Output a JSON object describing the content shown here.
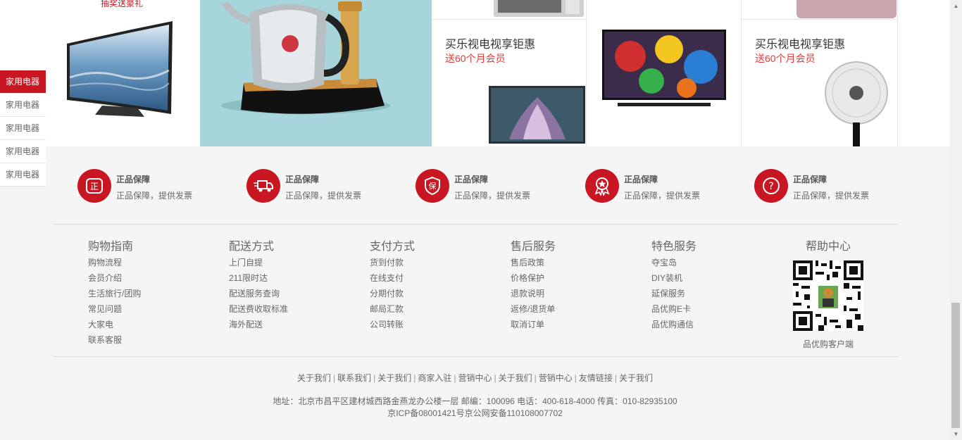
{
  "sidebar": {
    "items": [
      {
        "label": "家用电器",
        "active": true
      },
      {
        "label": "家用电器",
        "active": false
      },
      {
        "label": "家用电器",
        "active": false
      },
      {
        "label": "家用电器",
        "active": false
      },
      {
        "label": "家用电器",
        "active": false
      }
    ]
  },
  "products": {
    "tv_tag": "抽奖送豪礼",
    "promo_left": {
      "title": "买乐视电视享钜惠",
      "sub": "送60个月会员"
    },
    "promo_right": {
      "title": "买乐视电视享钜惠",
      "sub": "送60个月会员"
    }
  },
  "guarantees": [
    {
      "icon": "genuine-icon",
      "glyph": "正",
      "title": "正品保障",
      "desc": "正品保障，提供发票"
    },
    {
      "icon": "delivery-truck-icon",
      "glyph": "",
      "title": "正品保障",
      "desc": "正品保障，提供发票"
    },
    {
      "icon": "warranty-shield-icon",
      "glyph": "保",
      "title": "正品保障",
      "desc": "正品保障，提供发票"
    },
    {
      "icon": "award-ribbon-icon",
      "glyph": "",
      "title": "正品保障",
      "desc": "正品保障，提供发票"
    },
    {
      "icon": "help-question-icon",
      "glyph": "?",
      "title": "正品保障",
      "desc": "正品保障，提供发票"
    }
  ],
  "footer_columns": [
    {
      "title": "购物指南",
      "links": [
        "购物流程",
        "会员介绍",
        "生活旅行/团购",
        "常见问题",
        "大家电",
        "联系客服"
      ]
    },
    {
      "title": "配送方式",
      "links": [
        "上门自提",
        "211限时达",
        "配送服务查询",
        "配送费收取标准",
        "海外配送"
      ]
    },
    {
      "title": "支付方式",
      "links": [
        "货到付款",
        "在线支付",
        "分期付款",
        "邮局汇款",
        "公司转账"
      ]
    },
    {
      "title": "售后服务",
      "links": [
        "售后政策",
        "价格保护",
        "退款说明",
        "返修/退货单",
        "取消订单"
      ]
    },
    {
      "title": "特色服务",
      "links": [
        "夺宝岛",
        "DIY装机",
        "延保服务",
        "品优购E卡",
        "品优购通信"
      ]
    }
  ],
  "help": {
    "title": "帮助中心",
    "caption": "品优购客户端"
  },
  "bottom_links": [
    "关于我们",
    "联系我们",
    "关于我们",
    "商家入驻",
    "营销中心",
    "关于我们",
    "营销中心",
    "友情链接",
    "关于我们"
  ],
  "address": {
    "line1": "地址：北京市昌平区建材城西路金燕龙办公楼一层 邮编：100096 电话：400-618-4000 传真：010-82935100",
    "line2": "京ICP备08001421号京公网安备110108007702"
  },
  "colors": {
    "brand_red": "#c81623",
    "kettle_bg": "#a6d6db",
    "page_bg": "#f5f5f5"
  }
}
